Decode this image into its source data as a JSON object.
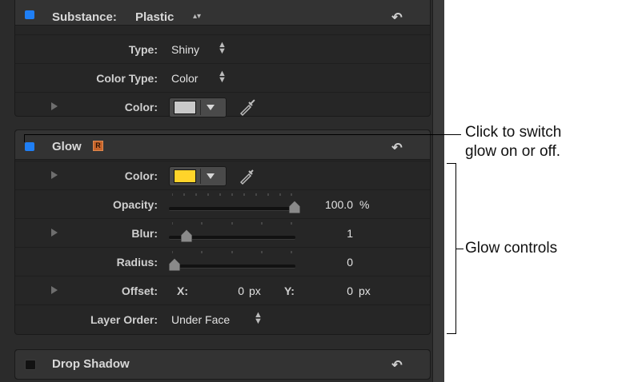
{
  "substance": {
    "title": "Substance:",
    "value": "Plastic",
    "stepper": "▴▾",
    "reset": "↶",
    "type_label": "Type:",
    "type_value": "Shiny",
    "color_type_label": "Color Type:",
    "color_type_value": "Color",
    "color_label": "Color:",
    "color_hex": "#c9c9c9"
  },
  "glow": {
    "title": "Glow",
    "badge": "R",
    "reset": "↶",
    "color_label": "Color:",
    "color_hex": "#ffd42a",
    "opacity_label": "Opacity:",
    "opacity_value": "100.0",
    "opacity_unit": "%",
    "opacity_level": 1.0,
    "blur_label": "Blur:",
    "blur_value": "1",
    "blur_level": 0.1,
    "radius_label": "Radius:",
    "radius_value": "0",
    "radius_level": 0.0,
    "offset_label": "Offset:",
    "offset_x_label": "X:",
    "offset_x_value": "0",
    "offset_x_unit": "px",
    "offset_y_label": "Y:",
    "offset_y_value": "0",
    "offset_y_unit": "px",
    "layer_order_label": "Layer Order:",
    "layer_order_value": "Under Face"
  },
  "drop_shadow": {
    "title": "Drop Shadow",
    "reset": "↶"
  },
  "annotations": {
    "checkbox_line1": "Click to switch",
    "checkbox_line2": "glow on or off.",
    "controls": "Glow controls"
  },
  "colors": {
    "accent": "#1f7ff5",
    "badge": "#c8642a"
  }
}
